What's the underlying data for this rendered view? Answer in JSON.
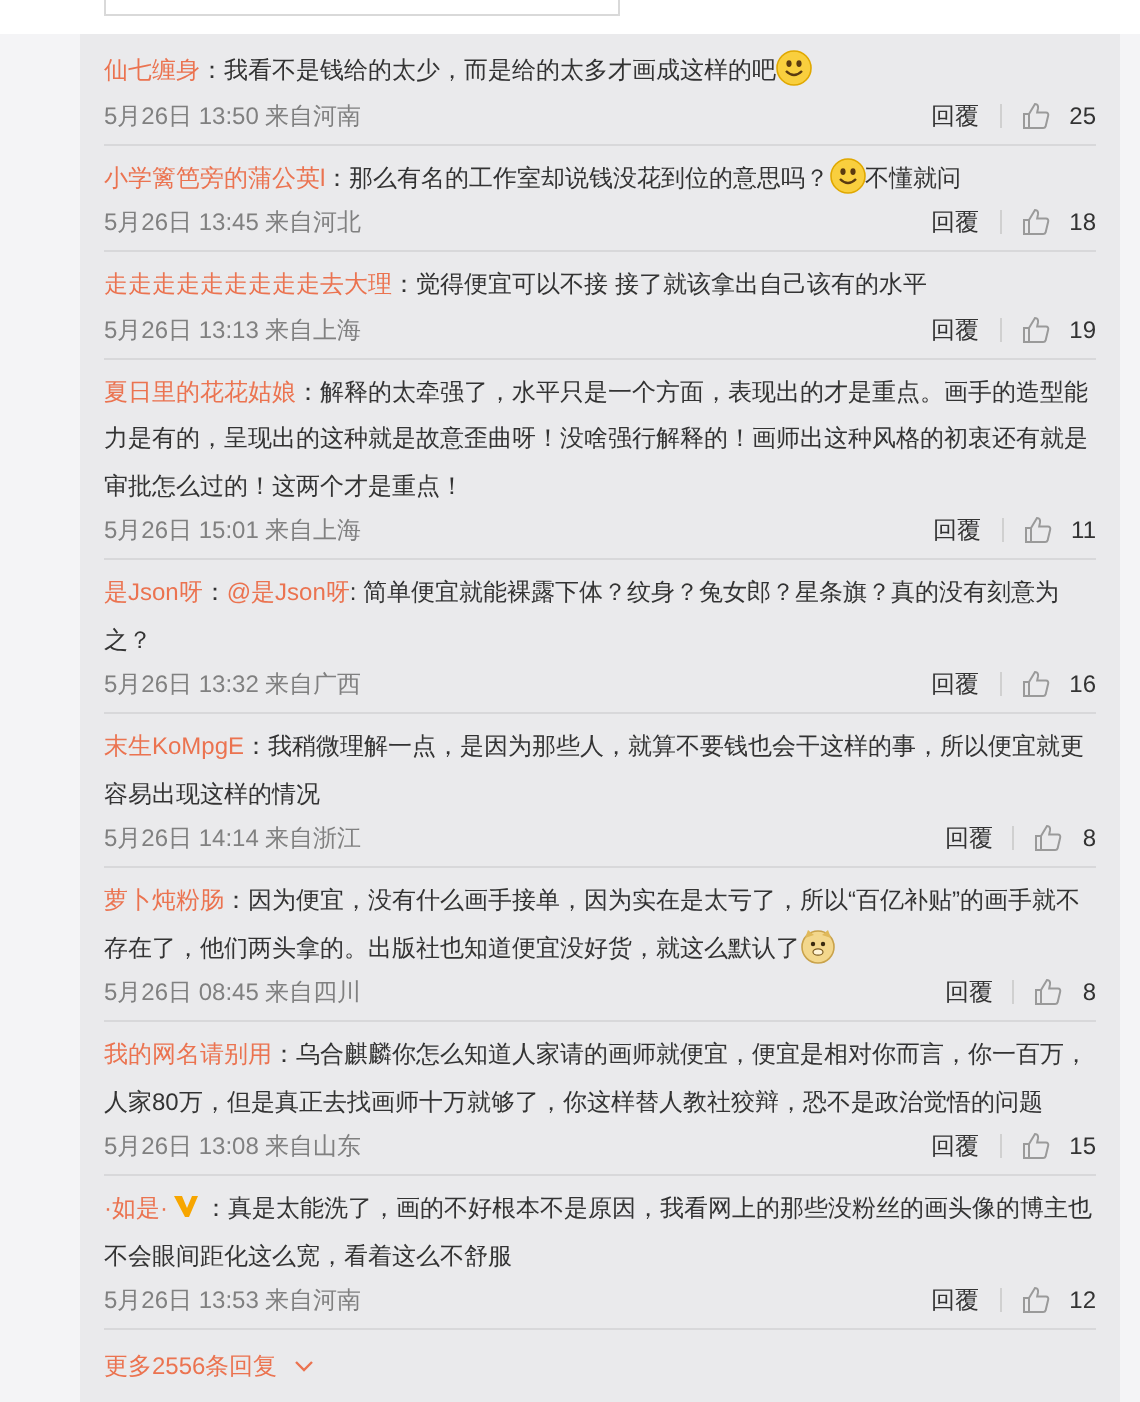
{
  "comments": [
    {
      "user": "仙七缠身",
      "verified": false,
      "parts": [
        {
          "kind": "text",
          "text": "：我看不是钱给的太少，而是给的太多才画成这样的吧"
        },
        {
          "kind": "smiley"
        }
      ],
      "meta": "5月26日 13:50 来自河南",
      "reply": "回覆",
      "likes": "25"
    },
    {
      "user": "小学篱笆旁的蒲公英l",
      "verified": false,
      "parts": [
        {
          "kind": "text",
          "text": "：那么有名的工作室却说钱没花到位的意思吗？"
        },
        {
          "kind": "smiley"
        },
        {
          "kind": "text",
          "text": "不懂就问"
        }
      ],
      "meta": "5月26日 13:45 来自河北",
      "reply": "回覆",
      "likes": "18"
    },
    {
      "user": "走走走走走走走走走去大理",
      "verified": false,
      "parts": [
        {
          "kind": "text",
          "text": "：觉得便宜可以不接 接了就该拿出自己该有的水平"
        }
      ],
      "meta": "5月26日 13:13 来自上海",
      "reply": "回覆",
      "likes": "19"
    },
    {
      "user": "夏日里的花花姑娘",
      "verified": false,
      "parts": [
        {
          "kind": "text",
          "text": "：解释的太牵强了，水平只是一个方面，表现出的才是重点。画手的造型能力是有的，呈现出的这种就是故意歪曲呀！没啥强行解释的！画师出这种风格的初衷还有就是审批怎么过的！这两个才是重点！"
        }
      ],
      "meta": "5月26日 15:01 来自上海",
      "reply": "回覆",
      "likes": "11"
    },
    {
      "user": "是Json呀",
      "verified": false,
      "parts": [
        {
          "kind": "text",
          "text": "："
        },
        {
          "kind": "mention",
          "text": "@是Json呀"
        },
        {
          "kind": "text",
          "text": ": 简单便宜就能裸露下体？纹身？兔女郎？星条旗？真的没有刻意为之？"
        }
      ],
      "meta": "5月26日 13:32 来自广西",
      "reply": "回覆",
      "likes": "16"
    },
    {
      "user": "末生KoMpgE",
      "verified": false,
      "parts": [
        {
          "kind": "text",
          "text": "：我稍微理解一点，是因为那些人，就算不要钱也会干这样的事，所以便宜就更容易出现这样的情况"
        }
      ],
      "meta": "5月26日 14:14 来自浙江",
      "reply": "回覆",
      "likes": "8"
    },
    {
      "user": "萝卜炖粉肠",
      "verified": false,
      "parts": [
        {
          "kind": "text",
          "text": "：因为便宜，没有什么画手接单，因为实在是太亏了，所以“百亿补贴”的画手就不存在了，他们两头拿的。出版社也知道便宜没好货，就这么默认了"
        },
        {
          "kind": "doge"
        }
      ],
      "meta": "5月26日 08:45 来自四川",
      "reply": "回覆",
      "likes": "8"
    },
    {
      "user": "我的网名请别用",
      "verified": false,
      "parts": [
        {
          "kind": "text",
          "text": "：乌合麒麟你怎么知道人家请的画师就便宜，便宜是相对你而言，你一百万，人家80万，但是真正去找画师十万就够了，你这样替人教社狡辩，恐不是政治觉悟的问题"
        }
      ],
      "meta": "5月26日 13:08 来自山东",
      "reply": "回覆",
      "likes": "15"
    },
    {
      "user": "·如是·",
      "verified": true,
      "parts": [
        {
          "kind": "text",
          "text": "：真是太能洗了，画的不好根本不是原因，我看网上的那些没粉丝的画头像的博主也不会眼间距化这么宽，看着这么不舒服"
        }
      ],
      "meta": "5月26日 13:53 来自河南",
      "reply": "回覆",
      "likes": "12"
    }
  ],
  "more": "更多2556条回复"
}
